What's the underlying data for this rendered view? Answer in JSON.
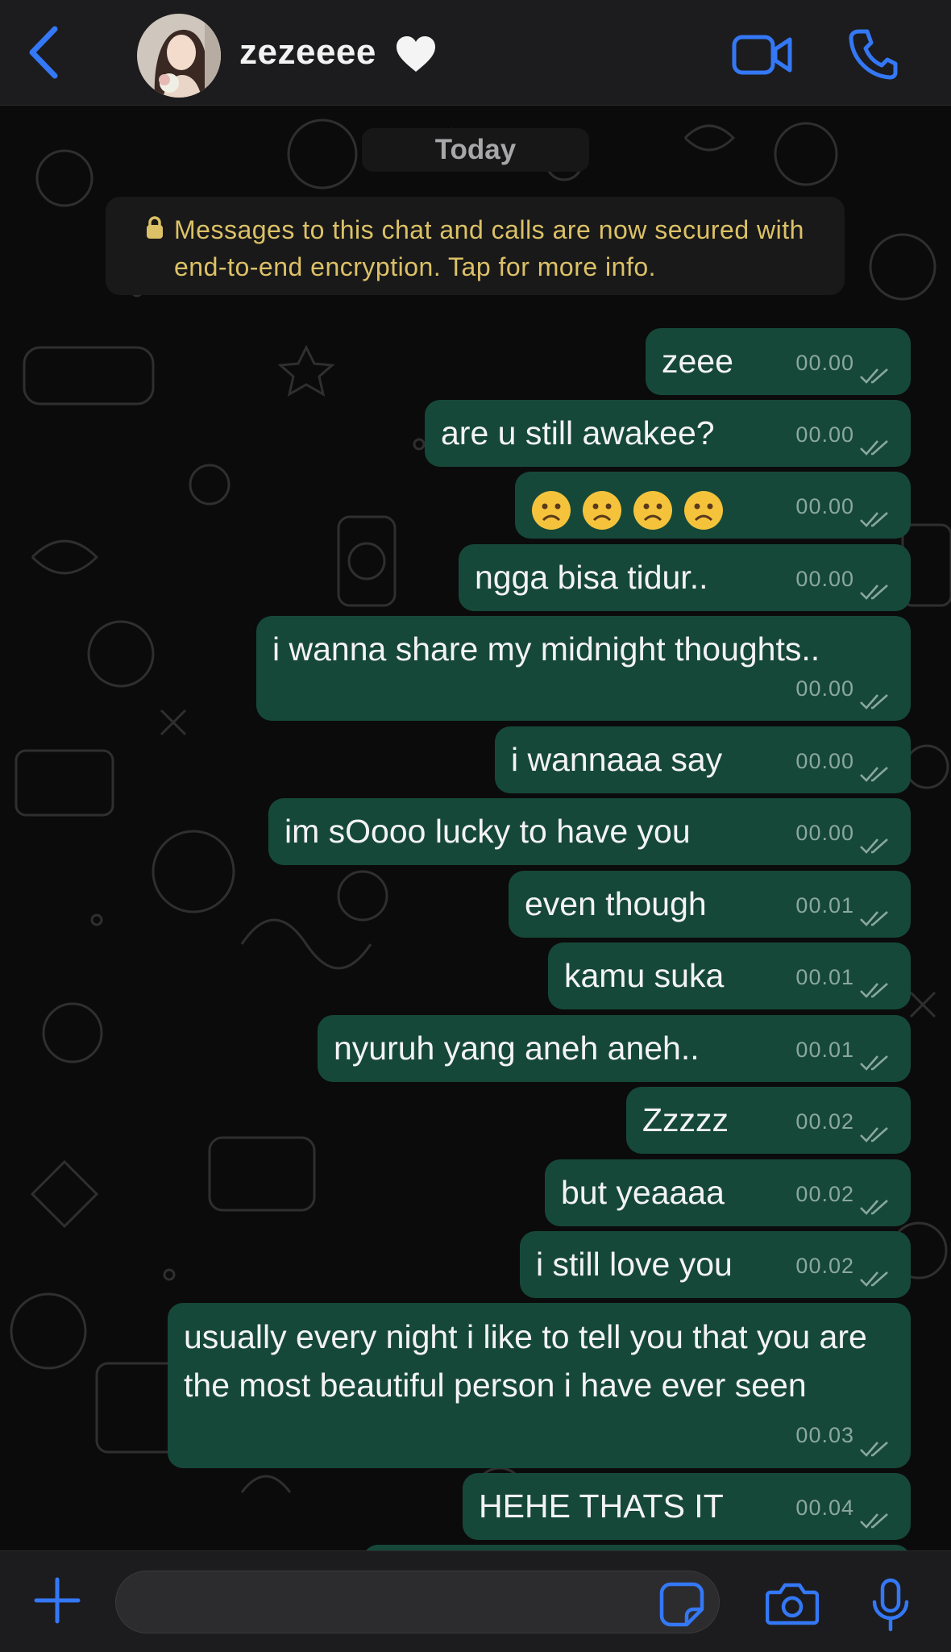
{
  "header": {
    "contact_name": "zezeeee",
    "icons": {
      "back": "chevron-left-icon",
      "status_emoji": "white-heart-icon",
      "video": "video-camera-icon",
      "call": "phone-icon"
    },
    "accent_color": "#3478f6"
  },
  "chat": {
    "date_label": "Today",
    "encryption_notice": "Messages to this chat and calls are now secured with end-to-end encryption. Tap for more info.",
    "messages": [
      {
        "text": "zeee",
        "time": "00.00"
      },
      {
        "text": "are u still awakee?",
        "time": "00.00"
      },
      {
        "text": "☹️☹️☹️☹️",
        "time": "00.00"
      },
      {
        "text": "ngga bisa tidur..",
        "time": "00.00"
      },
      {
        "text": "i wanna share my midnight thoughts..",
        "time": "00.00"
      },
      {
        "text": "i wannaaa say",
        "time": "00.00"
      },
      {
        "text": "im sOooo lucky to have you",
        "time": "00.00"
      },
      {
        "text": "even though",
        "time": "00.01"
      },
      {
        "text": "kamu suka",
        "time": "00.01"
      },
      {
        "text": "nyuruh yang aneh aneh..",
        "time": "00.01"
      },
      {
        "text": "Zzzzz",
        "time": "00.02"
      },
      {
        "text": "but yeaaaa",
        "time": "00.02"
      },
      {
        "text": "i still love you",
        "time": "00.02"
      },
      {
        "text": "usually every night i like to tell you that you are the most beautiful person i have ever seen",
        "time": "00.03"
      },
      {
        "text": "HEHE THATS IT",
        "time": "00.04"
      }
    ],
    "bubble_color": "#164839",
    "tick_status": "read-double-check-icon"
  },
  "composer": {
    "input_value": "",
    "icons": {
      "add": "plus-icon",
      "sticker": "sticker-icon",
      "camera": "camera-icon",
      "mic": "microphone-icon"
    }
  }
}
